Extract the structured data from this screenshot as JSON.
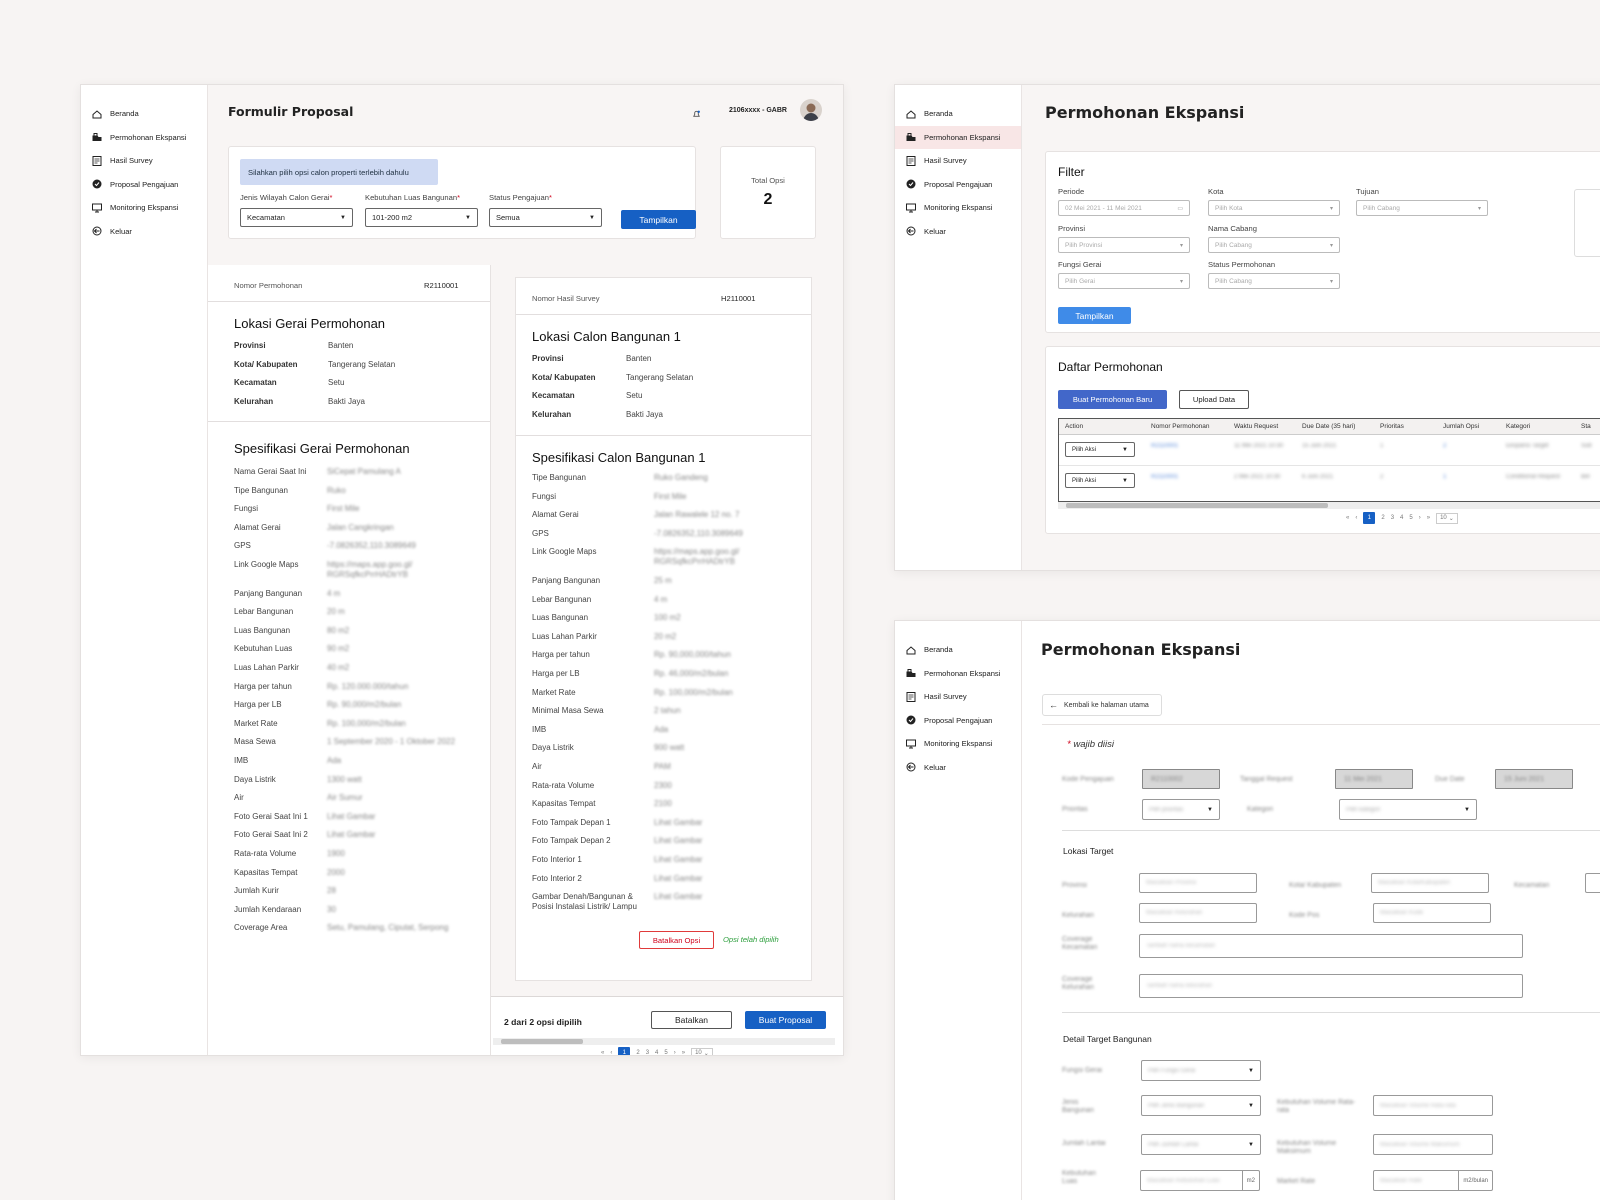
{
  "nav": [
    "Beranda",
    "Permohonan Ekspansi",
    "Hasil Survey",
    "Proposal Pengajuan",
    "Monitoring Ekspansi",
    "Keluar"
  ],
  "f1": {
    "title": "Formulir Proposal",
    "user": "2106xxxx - GABR",
    "info": "Silahkan pilih opsi calon properti terlebih dahulu",
    "filters": [
      {
        "label": "Jenis Wilayah Calon Gerai",
        "req": "*",
        "value": "Kecamatan"
      },
      {
        "label": "Kebutuhan Luas Bangunan",
        "req": "*",
        "value": "101-200 m2"
      },
      {
        "label": "Status Pengajuan",
        "req": "*",
        "value": "Semua"
      }
    ],
    "show_btn": "Tampilkan",
    "total_label": "Total Opsi",
    "total_value": "2",
    "left": {
      "no_label": "Nomor Permohonan",
      "no_value": "R2110001",
      "loc_title": "Lokasi Gerai Permohonan",
      "loc": [
        [
          "Provinsi",
          "Banten"
        ],
        [
          "Kota/ Kabupaten",
          "Tangerang Selatan"
        ],
        [
          "Kecamatan",
          "Setu"
        ],
        [
          "Kelurahan",
          "Bakti Jaya"
        ]
      ],
      "spec_title": "Spesifikasi Gerai Permohonan",
      "spec": [
        [
          "Nama Gerai Saat Ini",
          "SiCepat Pamulang A"
        ],
        [
          "Tipe Bangunan",
          "Ruko"
        ],
        [
          "Fungsi",
          "First Mile"
        ],
        [
          "Alamat Gerai",
          "Jalan Cangkringan"
        ],
        [
          "GPS",
          "-7.0826352,110.3089649"
        ],
        [
          "Link Google Maps",
          "https://maps.app.goo.gl/ RGRSqfkcPrrHADtrYB"
        ],
        [
          "Panjang Bangunan",
          "4 m"
        ],
        [
          "Lebar Bangunan",
          "20 m"
        ],
        [
          "Luas Bangunan",
          "80 m2"
        ],
        [
          "Kebutuhan Luas",
          "90 m2"
        ],
        [
          "Luas Lahan Parkir",
          "40 m2"
        ],
        [
          "Harga per tahun",
          "Rp. 120.000.000/tahun"
        ],
        [
          "Harga per LB",
          "Rp. 90,000/m2/bulan"
        ],
        [
          "Market Rate",
          "Rp. 100,000/m2/bulan"
        ],
        [
          "Masa Sewa",
          "1 September 2020 - 1 Oktober 2022"
        ],
        [
          "IMB",
          "Ada"
        ],
        [
          "Daya Listrik",
          "1300 watt"
        ],
        [
          "Air",
          "Air Sumur"
        ],
        [
          "Foto Gerai Saat Ini 1",
          "Lihat Gambar"
        ],
        [
          "Foto Gerai Saat Ini 2",
          "Lihat Gambar"
        ],
        [
          "Rata-rata Volume",
          "1900"
        ],
        [
          "Kapasitas Tempat",
          "2000"
        ],
        [
          "Jumlah Kurir",
          "28"
        ],
        [
          "Jumlah Kendaraan",
          "30"
        ],
        [
          "Coverage Area",
          "Setu, Pamulang, Ciputat, Serpong"
        ]
      ]
    },
    "right": {
      "no_label": "Nomor Hasil Survey",
      "no_value": "H2110001",
      "loc_title": "Lokasi Calon Bangunan 1",
      "loc": [
        [
          "Provinsi",
          "Banten"
        ],
        [
          "Kota/ Kabupaten",
          "Tangerang Selatan"
        ],
        [
          "Kecamatan",
          "Setu"
        ],
        [
          "Kelurahan",
          "Bakti Jaya"
        ]
      ],
      "spec_title": "Spesifikasi Calon Bangunan 1",
      "spec": [
        [
          "Tipe Bangunan",
          "Ruko Gandeng"
        ],
        [
          "Fungsi",
          "First Mile"
        ],
        [
          "Alamat Gerai",
          "Jalan Rawalele 12 no. 7"
        ],
        [
          "GPS",
          "-7.0826352,110.3089649"
        ],
        [
          "Link Google Maps",
          "https://maps.app.goo.gl/ RGRSqfkcPrrHADtrYB"
        ],
        [
          "Panjang Bangunan",
          "25 m"
        ],
        [
          "Lebar Bangunan",
          "4 m"
        ],
        [
          "Luas Bangunan",
          "100 m2"
        ],
        [
          "Luas Lahan Parkir",
          "20 m2"
        ],
        [
          "Harga per tahun",
          "Rp. 90,000,000/tahun"
        ],
        [
          "Harga per LB",
          "Rp. 46,000/m2/bulan"
        ],
        [
          "Market Rate",
          "Rp. 100,000/m2/bulan"
        ],
        [
          "Minimal Masa Sewa",
          "2 tahun"
        ],
        [
          "IMB",
          "Ada"
        ],
        [
          "Daya Listrik",
          "900 watt"
        ],
        [
          "Air",
          "PAM"
        ],
        [
          "Rata-rata Volume",
          "2300"
        ],
        [
          "Kapasitas Tempat",
          "2100"
        ],
        [
          "Foto Tampak Depan 1",
          "Lihat Gambar"
        ],
        [
          "Foto Tampak Depan 2",
          "Lihat Gambar"
        ],
        [
          "Foto Interior 1",
          "Lihat Gambar"
        ],
        [
          "Foto Interior 2",
          "Lihat Gambar"
        ],
        [
          "Gambar Denah/Bangunan & Posisi Instalasi Listrik/ Lampu",
          "Lihat Gambar"
        ]
      ],
      "cancel_btn": "Batalkan Opsi",
      "chosen": "Opsi telah dipilih"
    },
    "footer": {
      "count": "2 dari 2 opsi dipilih",
      "cancel": "Batalkan",
      "create": "Buat Proposal"
    },
    "pages": [
      "1",
      "2",
      "3",
      "4",
      "5"
    ],
    "per_page": "10"
  },
  "f2": {
    "title": "Permohonan Ekspansi",
    "filter_title": "Filter",
    "fields": [
      {
        "label": "Periode",
        "value": "02 Mei 2021 - 11 Mei 2021"
      },
      {
        "label": "Kota",
        "value": "Pilih Kota"
      },
      {
        "label": "Tujuan",
        "value": "Pilih Cabang"
      },
      {
        "label": "Provinsi",
        "value": "Pilih Provinsi"
      },
      {
        "label": "Nama Cabang",
        "value": "Pilih Cabang"
      },
      {
        "label": "Fungsi Gerai",
        "value": "Pilih Gerai"
      },
      {
        "label": "Status Permohonan",
        "value": "Pilih Cabang"
      }
    ],
    "show_btn": "Tampilkan",
    "list_title": "Daftar Permohonan",
    "new_btn": "Buat Permohonan Baru",
    "upload_btn": "Upload Data",
    "columns": [
      "Action",
      "Nomor Permohonan",
      "Waktu Request",
      "Due Date (35 hari)",
      "Prioritas",
      "Jumlah Opsi",
      "Kategori",
      "Sta"
    ],
    "action_value": "Pilih Aksi",
    "rows": [
      [
        "R2110001",
        "11 Mei 2021 10:30",
        "15 Juni 2021",
        "1",
        "2",
        "Ekspansi Target",
        "Sub"
      ],
      [
        "R2110001",
        "2 Mei 2021 10:30",
        "6 Juni 2021",
        "2",
        "1",
        "Conditional Request",
        "Bel"
      ]
    ],
    "pages": [
      "1",
      "2",
      "3",
      "4",
      "5"
    ],
    "per_page": "10"
  },
  "f3": {
    "title": "Permohonan Ekspansi",
    "back": "Kembali ke halaman utama",
    "required_note": "wajib diisi",
    "row1": [
      {
        "label": "Kode Pengajuan",
        "value": "R2110002"
      },
      {
        "label": "Tanggal Request",
        "value": "11 Mei 2021"
      },
      {
        "label": "Due Date",
        "value": "15 Juni 2021"
      }
    ],
    "row2": [
      {
        "label": "Prioritas",
        "value": "Pilih prioritas"
      },
      {
        "label": "Kategori",
        "value": "Pilih kategori"
      }
    ],
    "loc_title": "Lokasi Target",
    "loc_fields": [
      {
        "label": "Provinsi",
        "value": "Masukkan Provinsi"
      },
      {
        "label": "Kota/ Kabupaten",
        "value": "Masukkan Kota/Kabupaten"
      },
      {
        "label": "Kecamatan",
        "value": ""
      },
      {
        "label": "Kelurahan",
        "value": "Masukkan Kelurahan"
      },
      {
        "label": "Kode Pos",
        "value": "Masukkan Kode"
      }
    ],
    "coverage": [
      {
        "label": "Coverage Kecamatan",
        "value": "Tambah nama kecamatan"
      },
      {
        "label": "Coverage Kelurahan",
        "value": "Tambah nama kelurahan"
      }
    ],
    "detail_title": "Detail Target Bangunan",
    "detail": [
      {
        "label": "Fungsi Gerai",
        "value": "Pilih Fungsi Gerai"
      },
      {
        "label": "Jenis Bangunan",
        "value": "Pilih Jenis Bangunan"
      },
      {
        "label": "Kebutuhan Volume Rata-rata",
        "value": "Masukkan Volume Rata-rata"
      },
      {
        "label": "Jumlah Lantai",
        "value": "Pilih Jumlah Lantai"
      },
      {
        "label": "Kebutuhan Volume Maksimum",
        "value": "Masukkan Volume Maksimum"
      },
      {
        "label": "Kebutuhan Luas",
        "value": "Masukkan Kebutuhan Luas"
      },
      {
        "label": "Market Rate",
        "value": "Masukkan Rate"
      }
    ],
    "unit_m2": "m2",
    "unit_bulan": "m2/bulan"
  }
}
